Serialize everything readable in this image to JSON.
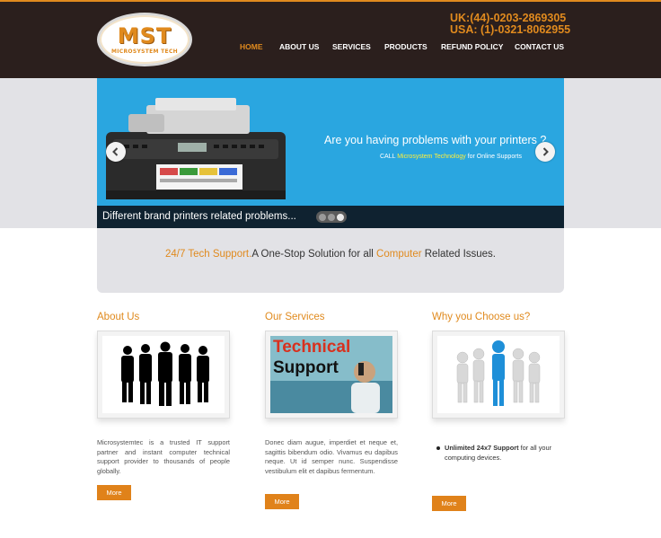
{
  "logo": {
    "main": "MST",
    "sub": "MICROSYSTEM TECH"
  },
  "contact": {
    "uk": "UK:(44)-0203-2869305",
    "usa": "USA: (1)-0321-8062955"
  },
  "nav": [
    {
      "label": "HOME",
      "active": true
    },
    {
      "label": "ABOUT US",
      "active": false
    },
    {
      "label": "SERVICES",
      "active": false
    },
    {
      "label": "PRODUCTS",
      "active": false
    },
    {
      "label": "REFUND POLICY",
      "active": false
    },
    {
      "label": "CONTACT US",
      "active": false
    }
  ],
  "slider": {
    "title": "Are you having problems with your printers ?",
    "sub_pre": "CALL",
    "sub_highlight": "Microsystem Technology",
    "sub_post": "for Online Supports",
    "caption": "Different brand printers related problems...",
    "dots_count": 3,
    "active_dot": 3
  },
  "tagline": {
    "part1": "24/7 Tech Support.",
    "part2": "A One-Stop Solution for all ",
    "part3": "Computer",
    "part4": " Related Issues."
  },
  "columns": {
    "about": {
      "title": "About Us",
      "text": "Microsystemtec is a trusted IT support partner and instant computer technical support provider to thousands of people globally.",
      "button": "More"
    },
    "services": {
      "title": "Our Services",
      "image_text_1": "Technical",
      "image_text_2": "Support",
      "text": "Donec diam augue, imperdiet et neque et, sagittis bibendum odio. Vivamus eu dapibus neque. Ut id semper nunc. Suspendisse vestibulum elit et dapibus fermentum.",
      "button": "More"
    },
    "why": {
      "title": "Why you Choose us?",
      "bullet_bold": "Unlimited 24x7 Support",
      "bullet_rest": " for all your computing devices.",
      "button": "More"
    }
  },
  "colors": {
    "accent": "#e08a1e",
    "header_bg": "#2b1f1d",
    "slider_bg": "#2aa6e0"
  }
}
